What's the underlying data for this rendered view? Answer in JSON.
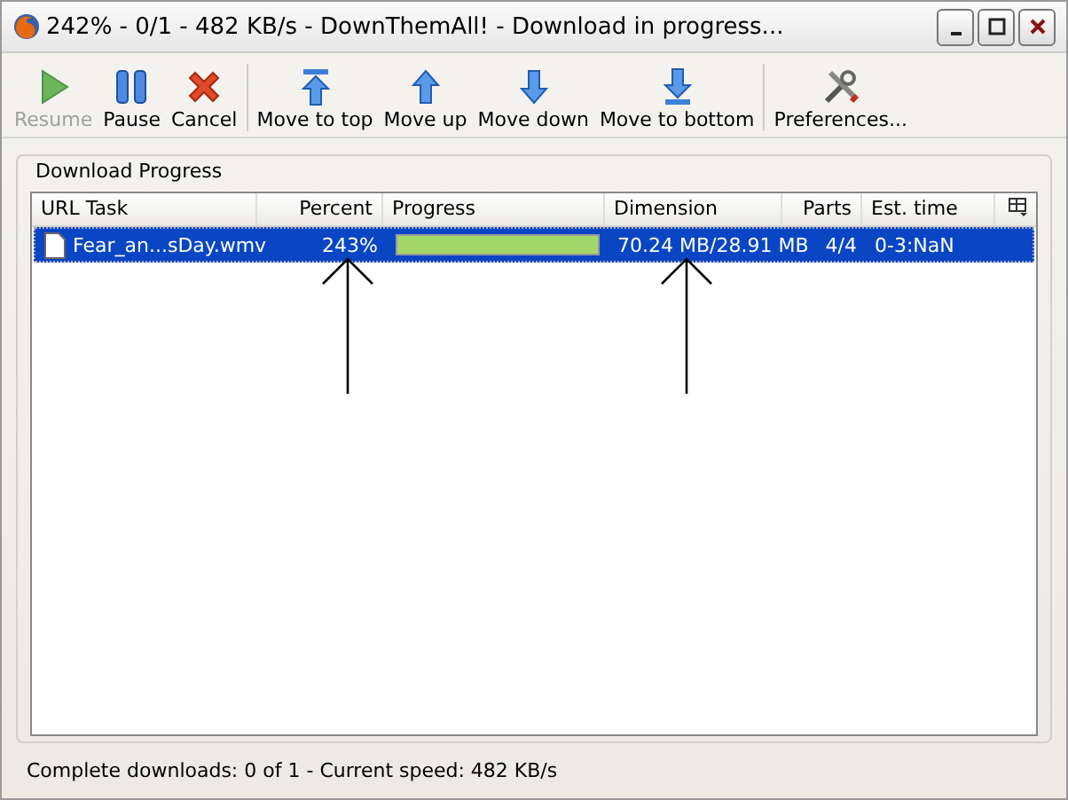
{
  "window": {
    "title": "242% - 0/1 - 482 KB/s - DownThemAll! - Download in progress..."
  },
  "toolbar": [
    {
      "label": "Resume",
      "kind": "play",
      "disabled": true
    },
    {
      "label": "Pause",
      "kind": "pause",
      "disabled": false
    },
    {
      "label": "Cancel",
      "kind": "cancel",
      "disabled": false
    },
    {
      "label": "Move to top",
      "kind": "top",
      "disabled": false,
      "separator_before": true
    },
    {
      "label": "Move up",
      "kind": "up",
      "disabled": false
    },
    {
      "label": "Move down",
      "kind": "down",
      "disabled": false
    },
    {
      "label": "Move to bottom",
      "kind": "bottom",
      "disabled": false
    },
    {
      "label": "Preferences...",
      "kind": "tools",
      "disabled": false,
      "separator_before": true
    }
  ],
  "group": {
    "title": "Download Progress"
  },
  "table": {
    "columns": [
      "URL Task",
      "Percent",
      "Progress",
      "Dimension",
      "Parts",
      "Est. time"
    ],
    "rows": [
      {
        "name": "Fear_an...sDay.wmv",
        "percent": "243%",
        "level": 1,
        "dimension": "70.24 MB/28.91 MB",
        "parts": "4/4",
        "est_time": "0-3:NaN",
        "selected": true
      }
    ]
  },
  "status_bar": "Complete downloads: 0 of 1 - Current speed: 482 KB/s"
}
